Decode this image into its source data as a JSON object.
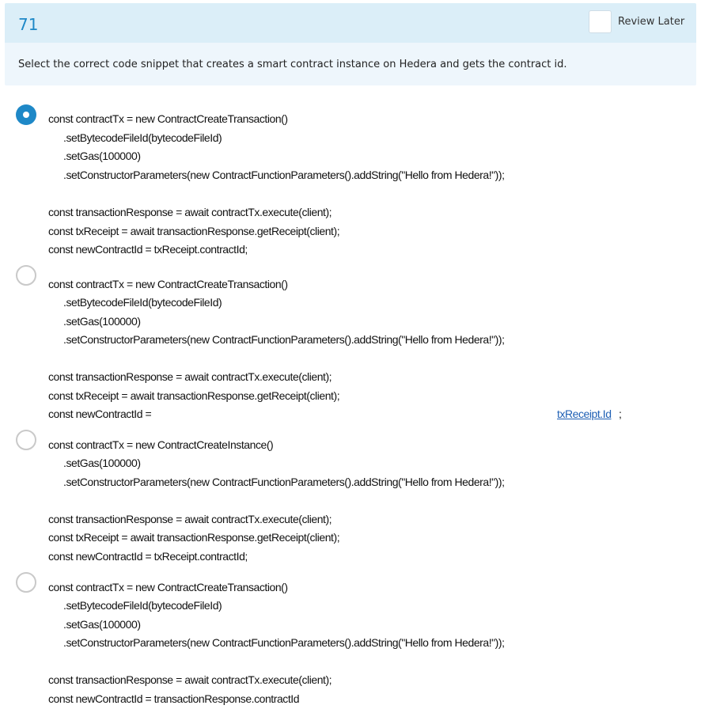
{
  "header": {
    "question_number": "71",
    "review_later_label": "Review Later",
    "review_later_checked": false
  },
  "question": {
    "text": "Select the correct code snippet that creates a smart contract instance on Hedera and gets the contract id."
  },
  "options": [
    {
      "selected": true,
      "lines": [
        "const contractTx = new ContractCreateTransaction()",
        ".setBytecodeFileId(bytecodeFileId)",
        ".setGas(100000)",
        ".setConstructorParameters(new ContractFunctionParameters().addString(\"Hello from Hedera!\"));",
        "const transactionResponse = await contractTx.execute(client);",
        "const txReceipt = await transactionResponse.getReceipt(client);",
        "const newContractId = txReceipt.contractId;"
      ]
    },
    {
      "selected": false,
      "lines": [
        "const contractTx = new ContractCreateTransaction()",
        ".setBytecodeFileId(bytecodeFileId)",
        ".setGas(100000)",
        ".setConstructorParameters(new ContractFunctionParameters().addString(\"Hello from Hedera!\"));",
        "const transactionResponse = await contractTx.execute(client);",
        "const txReceipt = await transactionResponse.getReceipt(client);",
        "const newContractId ="
      ],
      "link_text": "txReceipt.Id",
      "link_suffix": ";"
    },
    {
      "selected": false,
      "lines": [
        "const contractTx = new ContractCreateInstance()",
        ".setGas(100000)",
        ".setConstructorParameters(new ContractFunctionParameters().addString(\"Hello from Hedera!\"));",
        "const transactionResponse = await contractTx.execute(client);",
        "const txReceipt = await transactionResponse.getReceipt(client);",
        "const newContractId = txReceipt.contractId;"
      ]
    },
    {
      "selected": false,
      "lines": [
        "const contractTx = new ContractCreateTransaction()",
        ".setBytecodeFileId(bytecodeFileId)",
        ".setGas(100000)",
        ".setConstructorParameters(new ContractFunctionParameters().addString(\"Hello from Hedera!\"));",
        "const transactionResponse = await contractTx.execute(client);",
        "const newContractId = transactionResponse.contractId"
      ]
    }
  ]
}
